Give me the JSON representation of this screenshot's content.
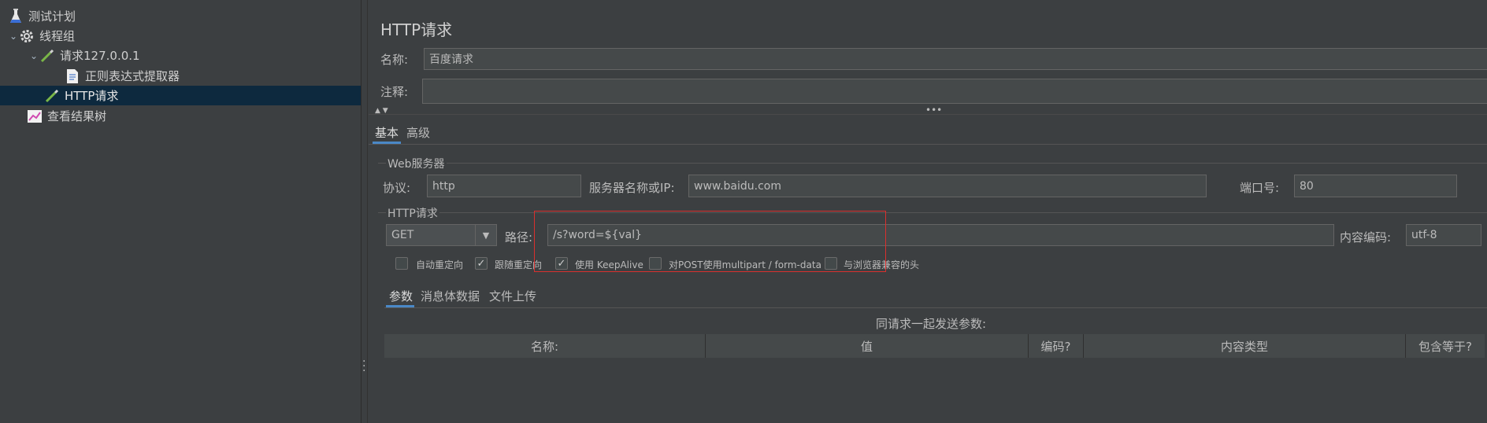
{
  "tree": {
    "items": [
      {
        "label": "测试计划",
        "icon": "flask-icon"
      },
      {
        "label": "线程组",
        "icon": "gear-icon"
      },
      {
        "label": "请求127.0.0.1",
        "icon": "pipette-icon"
      },
      {
        "label": "正则表达式提取器",
        "icon": "document-icon"
      },
      {
        "label": "HTTP请求",
        "icon": "pipette-icon",
        "selected": true
      },
      {
        "label": "查看结果树",
        "icon": "chart-icon"
      }
    ]
  },
  "panel": {
    "title": "HTTP请求",
    "name_label": "名称:",
    "name_value": "百度请求",
    "comment_label": "注释:",
    "comment_value": "",
    "tabs": [
      {
        "label": "基本",
        "active": true
      },
      {
        "label": "高级"
      }
    ],
    "web_server": {
      "group_title": "Web服务器",
      "protocol_label": "协议:",
      "protocol_value": "http",
      "server_label": "服务器名称或IP:",
      "server_value": "www.baidu.com",
      "port_label": "端口号:",
      "port_value": "80"
    },
    "http_request": {
      "group_title": "HTTP请求",
      "method_value": "GET",
      "path_label": "路径:",
      "path_value": "/s?word=${val}",
      "encoding_label": "内容编码:",
      "encoding_value": "utf-8",
      "options": [
        {
          "label": "自动重定向",
          "checked": false
        },
        {
          "label": "跟随重定向",
          "checked": true
        },
        {
          "label": "使用 KeepAlive",
          "checked": true
        },
        {
          "label": "对POST使用multipart / form-data",
          "checked": false
        },
        {
          "label": "与浏览器兼容的头",
          "checked": false
        }
      ]
    },
    "sub_tabs": [
      {
        "label": "参数",
        "active": true
      },
      {
        "label": "消息体数据"
      },
      {
        "label": "文件上传"
      }
    ],
    "params_caption": "同请求一起发送参数:",
    "table_headers": [
      "名称:",
      "值",
      "编码?",
      "内容类型",
      "包含等于?"
    ]
  },
  "colors": {
    "background": "#3c3f41",
    "selection": "#0d293e",
    "accent": "#4a88c7",
    "highlight_box": "#d9302e"
  }
}
